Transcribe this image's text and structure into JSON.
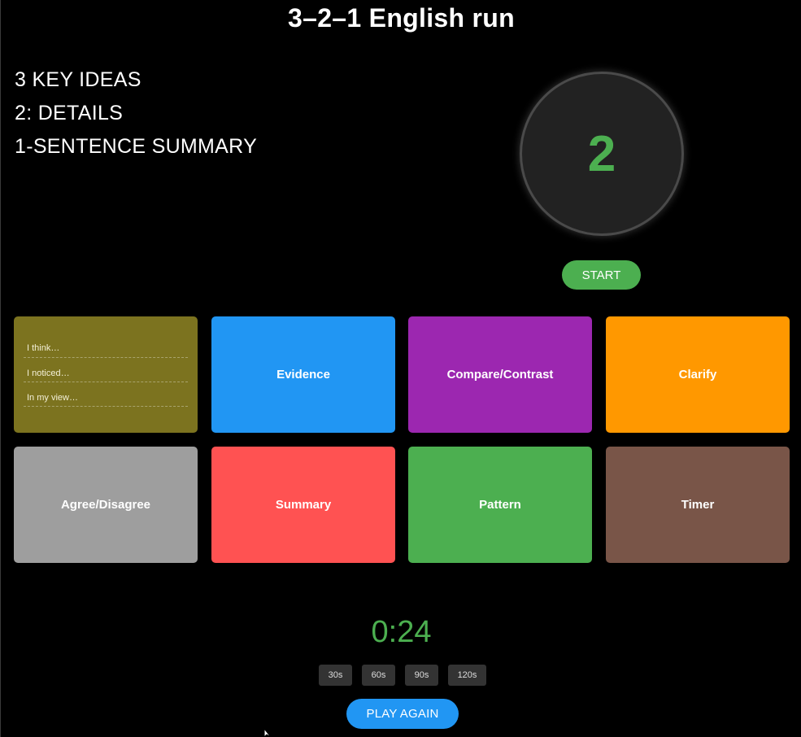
{
  "title": "3–2–1 English run",
  "steps": [
    "3 KEY IDEAS",
    "2: DETAILS",
    "1-SENTENCE SUMMARY"
  ],
  "dial": {
    "value": "2",
    "color": "#4caf50"
  },
  "start_label": "START",
  "cards": {
    "stems": {
      "color": "#7c731f",
      "lines": [
        "I think…",
        "I noticed…",
        "In my view…"
      ]
    },
    "evidence": {
      "label": "Evidence",
      "color": "#2196f3"
    },
    "compare": {
      "label": "Compare/Contrast",
      "color": "#9c27b0"
    },
    "clarify": {
      "label": "Clarify",
      "color": "#ff9800"
    },
    "agree": {
      "label": "Agree/Disagree",
      "color": "#9e9e9e"
    },
    "summary": {
      "label": "Summary",
      "color": "#ff5252"
    },
    "pattern": {
      "label": "Pattern",
      "color": "#4caf50"
    },
    "timer": {
      "label": "Timer",
      "color": "#795548"
    }
  },
  "timer": {
    "display": "0:24",
    "durations": [
      "30s",
      "60s",
      "90s",
      "120s"
    ]
  },
  "play_again_label": "PLAY AGAIN"
}
